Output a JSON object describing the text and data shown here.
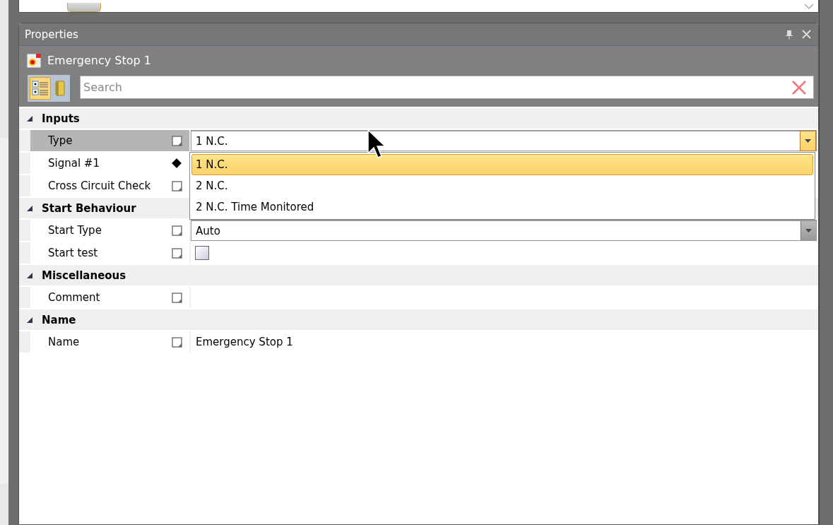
{
  "panel": {
    "title": "Properties",
    "object_title": "Emergency Stop 1"
  },
  "view_buttons": [
    {
      "kind": "categorized",
      "selected": true
    },
    {
      "kind": "alphabetical",
      "selected": false
    }
  ],
  "search": {
    "placeholder": "Search"
  },
  "categories": [
    {
      "title": "Inputs",
      "expanded": true,
      "properties": [
        {
          "name": "Type",
          "kind": "dropdown",
          "value": "1 N.C.",
          "selected": true,
          "linked": false,
          "open": true
        },
        {
          "name": "Signal #1",
          "kind": "plain",
          "selected": false,
          "linked": true
        },
        {
          "name": "Cross Circuit Check",
          "kind": "plain",
          "selected": false,
          "linked": false
        }
      ]
    },
    {
      "title": "Start Behaviour",
      "expanded": true,
      "properties": [
        {
          "name": "Start Type",
          "kind": "dropdown",
          "value": "Auto",
          "selected": false,
          "linked": false,
          "open": false
        },
        {
          "name": "Start test",
          "kind": "checkbox",
          "checked": false,
          "selected": false,
          "linked": false
        }
      ]
    },
    {
      "title": "Miscellaneous",
      "expanded": true,
      "properties": [
        {
          "name": "Comment",
          "kind": "text",
          "selected": false,
          "linked": false
        }
      ]
    },
    {
      "title": "Name",
      "expanded": true,
      "properties": [
        {
          "name": "Name",
          "kind": "text",
          "value": "Emergency Stop 1",
          "selected": false,
          "linked": false
        }
      ]
    }
  ],
  "dropdown_list": {
    "options": [
      {
        "label": "1 N.C.",
        "selected": true
      },
      {
        "label": "2 N.C.",
        "selected": false
      },
      {
        "label": "2 N.C. Time Monitored",
        "selected": false
      }
    ]
  }
}
